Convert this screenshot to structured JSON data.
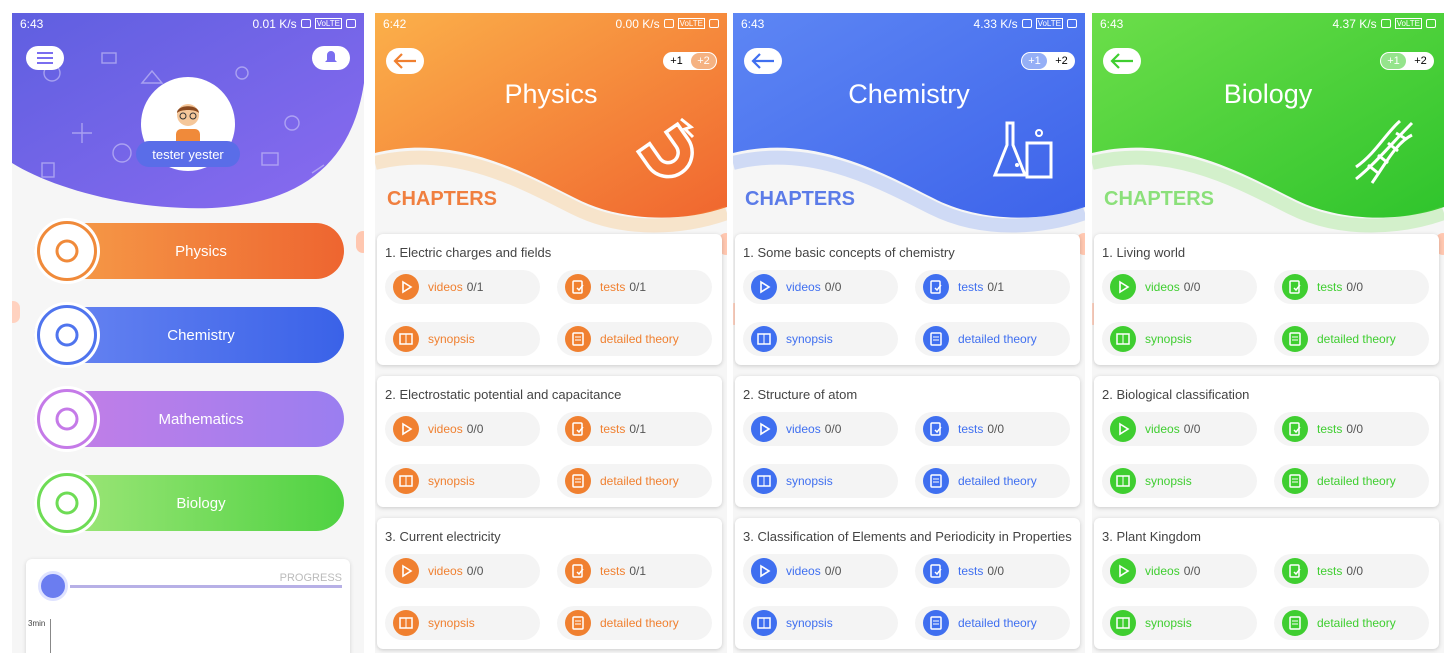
{
  "home": {
    "status": {
      "time": "6:43",
      "speed": "0.01 K/s",
      "lte": "VoLTE"
    },
    "user": "tester yester",
    "subjects": [
      {
        "label": "Physics",
        "colors": [
          "#f6a04a",
          "#ee6530"
        ],
        "ring": "#f08a3a"
      },
      {
        "label": "Chemistry",
        "colors": [
          "#6a86f2",
          "#3a62e8"
        ],
        "ring": "#4f74ee"
      },
      {
        "label": "Mathematics",
        "colors": [
          "#c77ee6",
          "#9a7ef0"
        ],
        "ring": "#c57ae8"
      },
      {
        "label": "Biology",
        "colors": [
          "#a6e87e",
          "#4fd242"
        ],
        "ring": "#6edc55"
      }
    ],
    "progress": {
      "label": "PROGRESS",
      "ytick": "3min"
    }
  },
  "screens": [
    {
      "status": {
        "time": "6:42",
        "speed": "0.00 K/s",
        "lte": "VoLTE"
      },
      "title": "Physics",
      "toggle": [
        "+1",
        "+2"
      ],
      "chapters_label": "CHAPTERS",
      "accent": "#f08030",
      "label_color": "#f07f3f",
      "grad": [
        "#fbb04a",
        "#f0662f"
      ],
      "chapters": [
        {
          "title": "1. Electric charges and fields",
          "videos": "0/1",
          "tests": "0/1"
        },
        {
          "title": "2. Electrostatic potential and capacitance",
          "videos": "0/0",
          "tests": "0/1"
        },
        {
          "title": "3. Current electricity",
          "videos": "0/0",
          "tests": "0/1"
        }
      ]
    },
    {
      "status": {
        "time": "6:43",
        "speed": "4.33 K/s",
        "lte": "VoLTE"
      },
      "title": "Chemistry",
      "toggle": [
        "+1",
        "+2"
      ],
      "chapters_label": "CHAPTERS",
      "accent": "#3f6ff0",
      "label_color": "#5b7be8",
      "grad": [
        "#5d86f4",
        "#3d63ea"
      ],
      "chapters": [
        {
          "title": "1. Some basic concepts of chemistry",
          "videos": "0/0",
          "tests": "0/1"
        },
        {
          "title": "2. Structure of atom",
          "videos": "0/0",
          "tests": "0/0"
        },
        {
          "title": "3. Classification of Elements and Periodicity in Properties",
          "videos": "0/0",
          "tests": "0/0"
        }
      ]
    },
    {
      "status": {
        "time": "6:43",
        "speed": "4.37 K/s",
        "lte": "VoLTE"
      },
      "title": "Biology",
      "toggle": [
        "+1",
        "+2"
      ],
      "chapters_label": "CHAPTERS",
      "accent": "#3fce30",
      "label_color": "#8be07a",
      "grad": [
        "#6cde4a",
        "#2fc42c"
      ],
      "chapters": [
        {
          "title": "1. Living world",
          "videos": "0/0",
          "tests": "0/0"
        },
        {
          "title": "2. Biological classification",
          "videos": "0/0",
          "tests": "0/0"
        },
        {
          "title": "3. Plant Kingdom",
          "videos": "0/0",
          "tests": "0/0"
        }
      ]
    }
  ],
  "labels": {
    "videos": "videos",
    "tests": "tests",
    "synopsis": "synopsis",
    "theory": "detailed theory"
  },
  "icons": [
    "menu-icon",
    "bell-icon",
    "avatar",
    "back-arrow-icon",
    "magnet-icon",
    "flask-icon",
    "dna-icon",
    "compass-icon",
    "play-icon",
    "test-icon",
    "book-icon",
    "theory-icon",
    "chart-icon"
  ]
}
